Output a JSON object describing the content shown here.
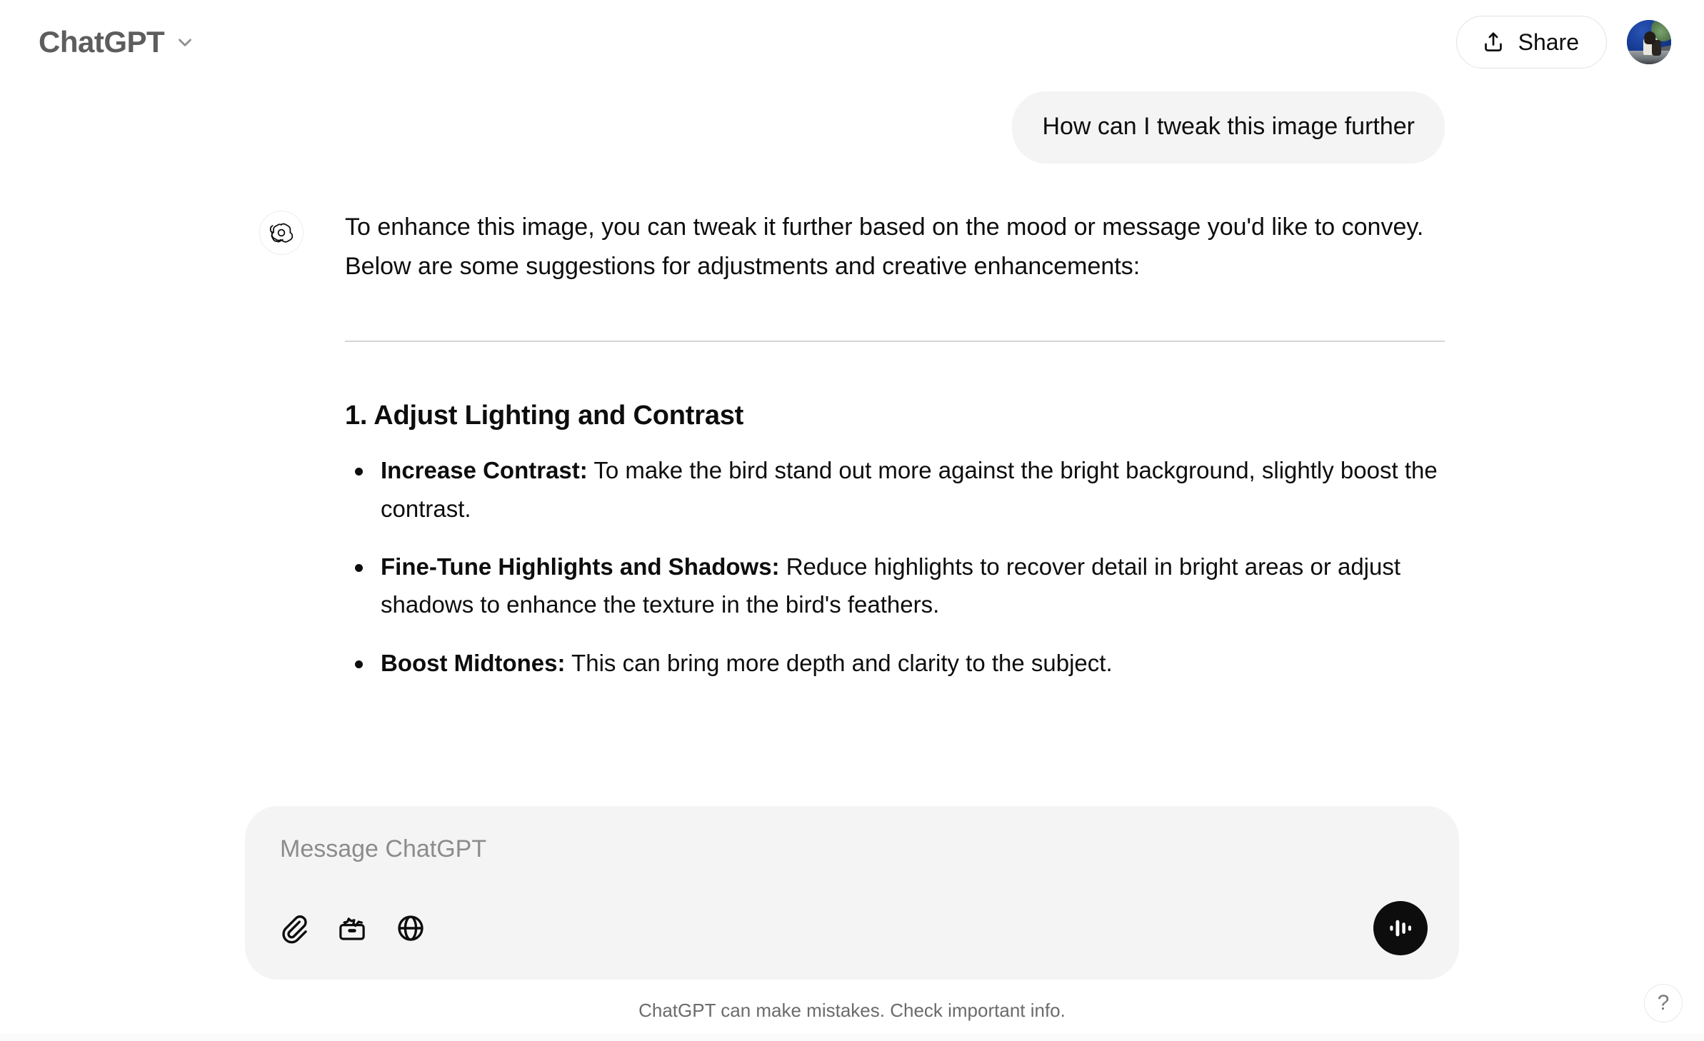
{
  "header": {
    "model_title": "ChatGPT",
    "model_caret_icon": "chevron-down-icon",
    "share_label": "Share",
    "share_icon": "share-upload-icon",
    "avatar_icon": "user-avatar"
  },
  "conversation": {
    "user_message": "How can I tweak this image further",
    "assistant": {
      "avatar_icon": "openai-logo-icon",
      "paragraphs": [
        "To enhance this image, you can tweak it further based on the mood or message you'd like to convey.",
        "Below are some suggestions for adjustments and creative enhancements:"
      ],
      "section_heading": "1. Adjust Lighting and Contrast",
      "bullets": [
        {
          "term": "Increase Contrast:",
          "text": " To make the bird stand out more against the bright background, slightly boost the contrast."
        },
        {
          "term": "Fine-Tune Highlights and Shadows:",
          "text": " Reduce highlights to recover detail in bright areas or adjust shadows to enhance the texture in the bird's feathers."
        },
        {
          "term": "Boost Midtones:",
          "text": " This can bring more depth and clarity to the subject."
        }
      ]
    }
  },
  "scroll_to_bottom": {
    "icon": "arrow-down-icon"
  },
  "composer": {
    "placeholder": "Message ChatGPT",
    "value": "",
    "tools": [
      {
        "name": "attach-file-button",
        "icon": "paperclip-icon"
      },
      {
        "name": "tools-button",
        "icon": "toolbox-sparkle-icon"
      },
      {
        "name": "web-search-button",
        "icon": "globe-icon"
      }
    ],
    "voice_button_icon": "voice-waveform-icon"
  },
  "footer": {
    "disclaimer": "ChatGPT can make mistakes. Check important info.",
    "help_label": "?"
  },
  "colors": {
    "background": "#ffffff",
    "user_bubble": "#f4f4f4",
    "composer_bg": "#f4f4f4",
    "text": "#0d0d0d",
    "muted_text": "#6b6b6b",
    "placeholder": "#8c8c8c",
    "model_title": "#5d5d5d",
    "divider": "#d6d6d6",
    "voice_button": "#0d0d0d"
  }
}
